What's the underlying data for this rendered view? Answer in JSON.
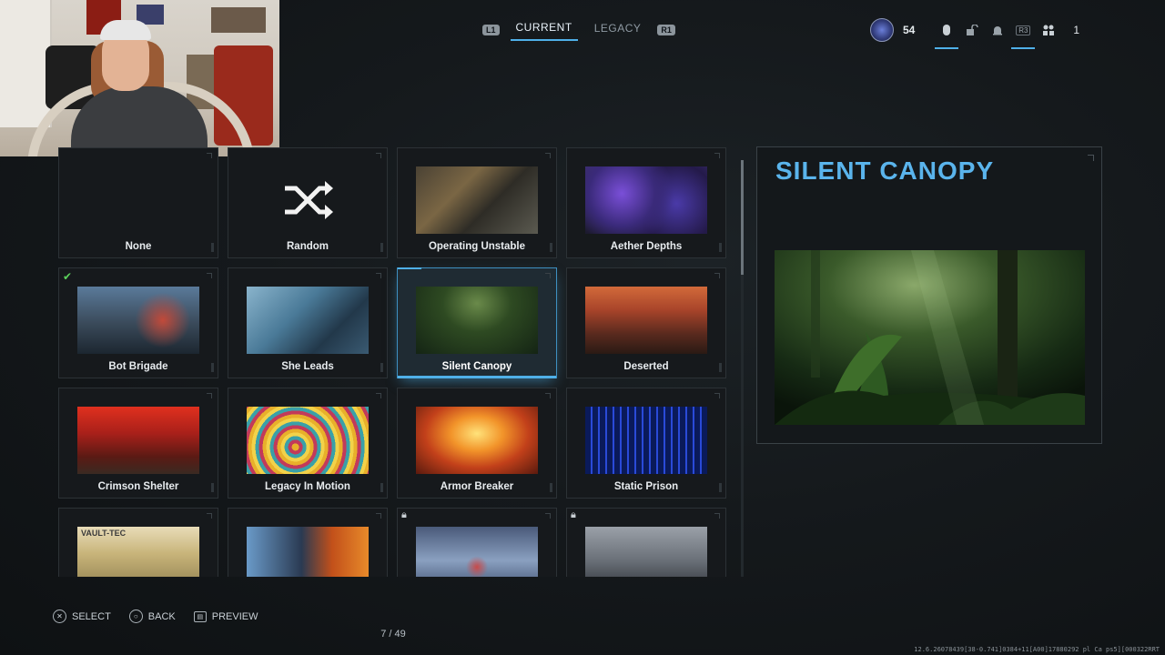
{
  "tabs": {
    "left_bumper": "L1",
    "right_bumper": "R1",
    "items": [
      {
        "label": "CURRENT",
        "active": true
      },
      {
        "label": "LEGACY",
        "active": false
      }
    ]
  },
  "hud": {
    "level": "54",
    "r3_label": "R3",
    "party_count": "1",
    "icons": [
      "prestige-emblem",
      "mouse-icon",
      "unlock-icon",
      "bell-icon",
      "controller-icon",
      "party-icon"
    ]
  },
  "grid": {
    "tiles": [
      {
        "name": "None",
        "type": "empty"
      },
      {
        "name": "Random",
        "type": "shuffle"
      },
      {
        "name": "Operating Unstable",
        "type": "image"
      },
      {
        "name": "Aether Depths",
        "type": "image"
      },
      {
        "name": "Bot Brigade",
        "type": "image",
        "equipped": true
      },
      {
        "name": "She Leads",
        "type": "image"
      },
      {
        "name": "Silent Canopy",
        "type": "image",
        "selected": true
      },
      {
        "name": "Deserted",
        "type": "image"
      },
      {
        "name": "Crimson Shelter",
        "type": "image"
      },
      {
        "name": "Legacy In Motion",
        "type": "image"
      },
      {
        "name": "Armor Breaker",
        "type": "image"
      },
      {
        "name": "Static Prison",
        "type": "image"
      },
      {
        "name": "",
        "type": "image"
      },
      {
        "name": "",
        "type": "image"
      },
      {
        "name": "",
        "type": "image",
        "locked": true
      },
      {
        "name": "",
        "type": "image",
        "locked": true
      }
    ],
    "vault_text": "VAULT-TEC"
  },
  "preview": {
    "title": "SILENT CANOPY"
  },
  "footer": {
    "select_label": "SELECT",
    "back_label": "BACK",
    "preview_label": "PREVIEW"
  },
  "pager": "7 / 49",
  "build_string": "12.6.26078439[38-0.741]0384+11[A00]17880292 pl Ca ps5][000322RRT",
  "colors": {
    "accent": "#4fb0e8",
    "title": "#5ab4ec",
    "equipped_check": "#5bd15b"
  }
}
